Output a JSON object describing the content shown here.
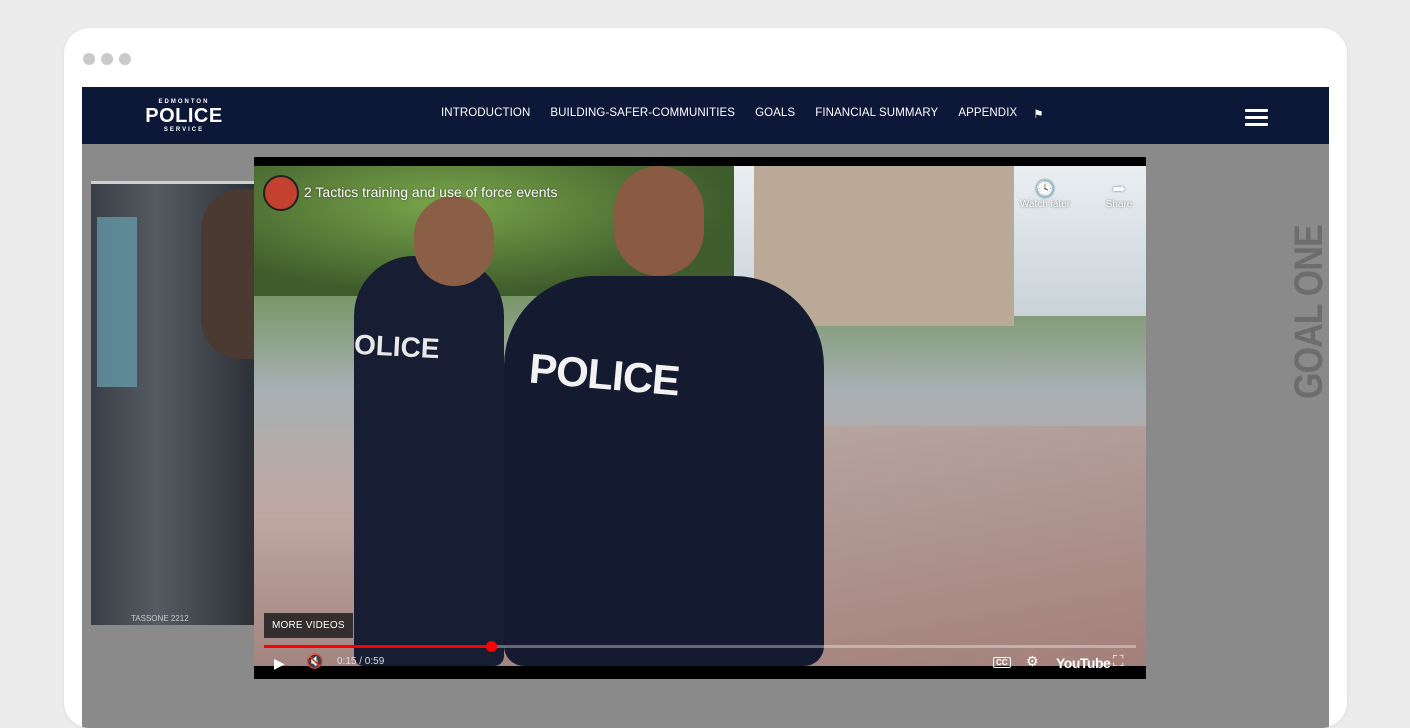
{
  "browser": {
    "dots": [
      "dot",
      "dot",
      "dot"
    ]
  },
  "nav": {
    "logo_top": "EDMONTON",
    "logo_main": "POLICE",
    "logo_bottom": "SERVICE",
    "links": [
      "INTRODUCTION",
      "BUILDING-SAFER-COMMUNITIES",
      "GOALS",
      "FINANCIAL SUMMARY",
      "APPENDIX"
    ],
    "extra_icon": "shield-icon",
    "menu_icon": "hamburger-icon"
  },
  "side_label": "GOAL ONE",
  "bg_photo_caption": "TASSONE 2212",
  "video": {
    "title": "2 Tactics training and use of force events",
    "watch_later": "Watch later",
    "share": "Share",
    "more_videos": "MORE VIDEOS",
    "time": "0:15 / 0:59",
    "progress": 0.26,
    "cc_label": "CC",
    "brand": "YouTube",
    "scene_text_left": "OLICE",
    "scene_text_right": "POLICE"
  }
}
